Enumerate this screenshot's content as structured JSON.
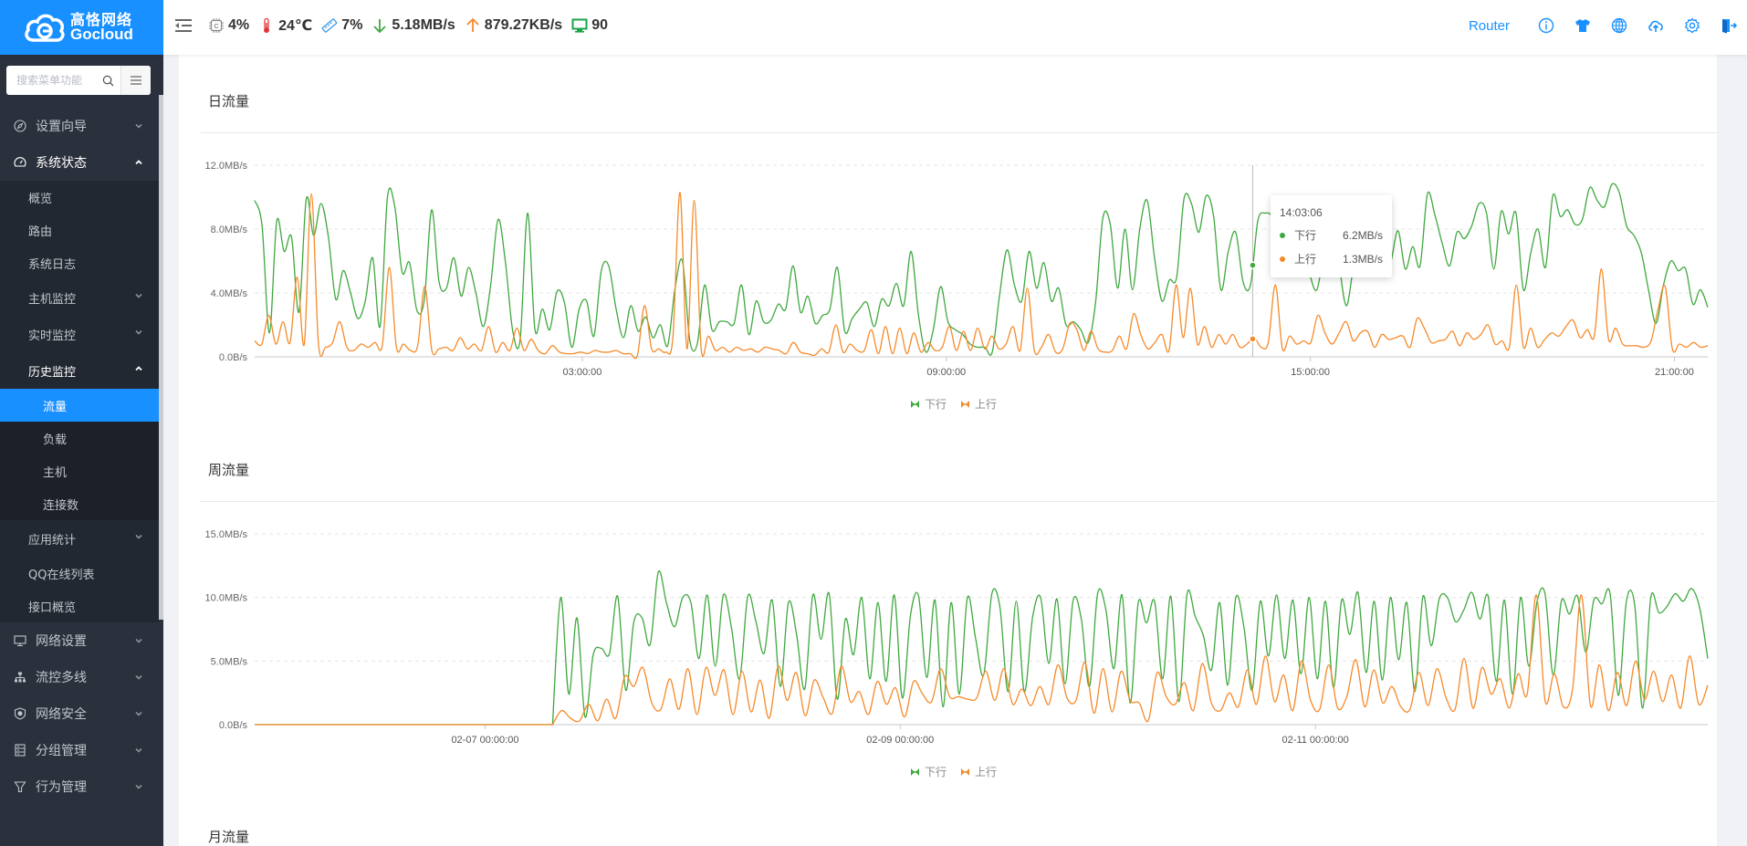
{
  "header": {
    "brand_cn": "高恪网络",
    "brand_en": "Gocloud",
    "stats": {
      "cpu": "4%",
      "temperature": "24℃",
      "memory": "7%",
      "download": "5.18MB/s",
      "upload": "879.27KB/s",
      "hosts": "90"
    },
    "router_label": "Router",
    "icons": [
      "info-icon",
      "theme-shirt-icon",
      "globe-icon",
      "cloud-upload-icon",
      "settings-gear-icon",
      "logout-icon"
    ]
  },
  "colors": {
    "brand": "#1890ff",
    "download": "#3fa83f",
    "upload": "#f58a2a",
    "temperature": "#e5333a",
    "sidebar_bg": "#2b313c"
  },
  "sidebar": {
    "search_placeholder": "搜索菜单功能",
    "menu": [
      {
        "label": "设置向导",
        "icon": "compass-icon",
        "expanded": false
      },
      {
        "label": "系统状态",
        "icon": "dashboard-icon",
        "expanded": true,
        "children": [
          {
            "label": "概览"
          },
          {
            "label": "路由"
          },
          {
            "label": "系统日志"
          },
          {
            "label": "主机监控",
            "has_children": true,
            "expanded": false
          },
          {
            "label": "实时监控",
            "has_children": true,
            "expanded": false
          },
          {
            "label": "历史监控",
            "has_children": true,
            "expanded": true,
            "children": [
              {
                "label": "流量",
                "active": true
              },
              {
                "label": "负载"
              },
              {
                "label": "主机"
              },
              {
                "label": "连接数"
              }
            ]
          },
          {
            "label": "应用统计",
            "has_children": true,
            "expanded": false
          },
          {
            "label": "QQ在线列表"
          },
          {
            "label": "接口概览"
          }
        ]
      },
      {
        "label": "网络设置",
        "icon": "monitor-icon",
        "expanded": false
      },
      {
        "label": "流控多线",
        "icon": "network-topology-icon",
        "expanded": false
      },
      {
        "label": "网络安全",
        "icon": "shield-icon",
        "expanded": false
      },
      {
        "label": "分组管理",
        "icon": "group-list-icon",
        "expanded": false
      },
      {
        "label": "行为管理",
        "icon": "filter-funnel-icon",
        "expanded": false
      }
    ]
  },
  "main": {
    "sections": [
      {
        "title": "日流量"
      },
      {
        "title": "周流量"
      },
      {
        "title": "月流量"
      }
    ],
    "tooltip": {
      "time": "14:03:06",
      "rows": [
        {
          "name": "下行",
          "value": "6.2MB/s"
        },
        {
          "name": "上行",
          "value": "1.3MB/s"
        }
      ]
    }
  },
  "chart_data": [
    {
      "type": "line",
      "title": "日流量",
      "xlabel": "",
      "ylabel": "",
      "x_unit": "hours",
      "x_range": [
        -2.4,
        21.55
      ],
      "x_ticks": [
        {
          "value": 3,
          "label": "03:00:00"
        },
        {
          "value": 9,
          "label": "09:00:00"
        },
        {
          "value": 15,
          "label": "15:00:00"
        },
        {
          "value": 21,
          "label": "21:00:00"
        }
      ],
      "y_unit": "MB/s",
      "ylim": [
        0,
        12
      ],
      "y_ticks": [
        {
          "value": 0,
          "label": "0.0B/s"
        },
        {
          "value": 4,
          "label": "4.0MB/s"
        },
        {
          "value": 8,
          "label": "8.0MB/s"
        },
        {
          "value": 12,
          "label": "12.0MB/s"
        }
      ],
      "grid": true,
      "legend": "bottom-center",
      "crosshair_x": 14.05,
      "series": [
        {
          "name": "下行",
          "color": "#3fa83f",
          "values": [
            9.8,
            8.2,
            1.5,
            8.5,
            6.6,
            7.5,
            2.8,
            9.9,
            7.6,
            9.6,
            7.5,
            3.6,
            5.4,
            4.0,
            2.4,
            3.5,
            6.2,
            1.9,
            10.0,
            9.4,
            5.3,
            5.9,
            2.9,
            3.6,
            9.2,
            4.7,
            4.3,
            6.2,
            3.8,
            5.6,
            4.0,
            1.9,
            4.5,
            8.6,
            5.9,
            1.6,
            1.1,
            9.0,
            1.7,
            3.0,
            1.7,
            4.1,
            3.4,
            0.6,
            3.0,
            3.5,
            1.3,
            5.4,
            5.7,
            3.0,
            1.2,
            3.2,
            1.6,
            2.5,
            1.2,
            2.0,
            0.7,
            4.3,
            6.0,
            1.0,
            0.8,
            4.5,
            1.7,
            2.2,
            2.2,
            2.1,
            4.5,
            1.4,
            3.5,
            2.2,
            2.3,
            3.3,
            3.0,
            5.7,
            2.8,
            3.8,
            2.1,
            2.6,
            3.0,
            5.6,
            1.6,
            2.4,
            3.0,
            3.4,
            1.9,
            3.6,
            3.2,
            4.6,
            3.2,
            6.6,
            2.6,
            0.3,
            1.7,
            4.4,
            2.2,
            1.7,
            1.4,
            0.8,
            0.6,
            0.6,
            0.3,
            3.9,
            6.7,
            4.5,
            3.5,
            6.6,
            4.3,
            5.9,
            3.5,
            4.3,
            2.0,
            2.2,
            1.7,
            0.9,
            3.4,
            8.7,
            8.3,
            4.3,
            8.0,
            4.2,
            8.0,
            9.8,
            6.2,
            3.5,
            4.8,
            5.0,
            9.9,
            9.6,
            7.8,
            10.1,
            8.8,
            4.2,
            6.6,
            7.8,
            4.7,
            4.5,
            8.5,
            9.0,
            8.7,
            6.9,
            6.2,
            7.9,
            6.7,
            5.2,
            4.2,
            6.8,
            10.0,
            6.0,
            3.2,
            5.6,
            6.2,
            6.1,
            8.7,
            5.8,
            5.9,
            7.9,
            5.5,
            6.9,
            5.7,
            10.2,
            8.9,
            7.1,
            5.7,
            7.8,
            7.4,
            8.2,
            9.6,
            9.0,
            5.5,
            9.1,
            7.7,
            9.0,
            4.2,
            6.5,
            8.0,
            5.6,
            10.1,
            8.8,
            9.2,
            8.3,
            8.6,
            10.6,
            9.8,
            9.4,
            10.8,
            10.3,
            8.2,
            7.6,
            6.5,
            4.1,
            2.1,
            4.5,
            6.0,
            5.4,
            5.5,
            3.3,
            4.2,
            3.1
          ]
        },
        {
          "name": "上行",
          "color": "#f58a2a",
          "values": [
            1.0,
            0.8,
            2.6,
            0.8,
            2.2,
            0.9,
            5.0,
            0.8,
            10.2,
            0.8,
            0.6,
            0.9,
            2.2,
            0.6,
            0.4,
            0.8,
            0.6,
            0.9,
            0.7,
            5.6,
            0.6,
            0.8,
            0.4,
            0.7,
            4.4,
            0.4,
            0.5,
            0.6,
            0.4,
            1.2,
            0.5,
            0.8,
            0.4,
            1.9,
            0.3,
            0.9,
            0.4,
            1.8,
            0.4,
            1.1,
            0.4,
            0.2,
            0.7,
            0.3,
            0.2,
            0.2,
            0.3,
            0.2,
            0.4,
            0.3,
            0.3,
            0.4,
            0.2,
            0.2,
            0.1,
            3.2,
            0.5,
            0.5,
            0.3,
            1.2,
            10.3,
            0.5,
            9.8,
            0.5,
            1.3,
            0.4,
            0.6,
            0.3,
            0.6,
            0.4,
            0.5,
            0.3,
            0.6,
            0.5,
            0.4,
            0.2,
            0.9,
            0.3,
            0.2,
            0.1,
            0.5,
            0.3,
            2.0,
            0.3,
            0.8,
            0.4,
            0.4,
            1.7,
            0.2,
            1.9,
            0.2,
            1.8,
            0.2,
            1.5,
            0.3,
            0.9,
            0.4,
            0.6,
            1.9,
            0.4,
            1.6,
            0.4,
            1.8,
            0.5,
            1.3,
            0.5,
            0.8,
            1.9,
            0.4,
            4.3,
            0.4,
            0.6,
            1.4,
            0.3,
            0.5,
            2.1,
            1.7,
            0.4,
            1.6,
            0.5,
            0.3,
            0.4,
            1.3,
            0.5,
            2.7,
            1.4,
            0.5,
            0.9,
            1.4,
            0.4,
            4.5,
            1.2,
            4.3,
            0.8,
            1.9,
            0.6,
            1.4,
            0.8,
            1.4,
            0.6,
            0.8,
            1.2,
            0.6,
            0.9,
            4.5,
            0.5,
            1.3,
            0.8,
            1.0,
            0.9,
            2.6,
            1.5,
            0.8,
            1.5,
            2.2,
            1.0,
            1.5,
            1.6,
            0.6,
            1.4,
            1.1,
            1.2,
            1.3,
            0.6,
            2.4,
            1.8,
            0.9,
            1.0,
            1.1,
            1.6,
            0.7,
            1.5,
            1.1,
            1.4,
            2.0,
            0.8,
            1.0,
            0.6,
            4.5,
            0.6,
            1.8,
            0.6,
            1.1,
            1.5,
            1.3,
            1.9,
            2.3,
            1.2,
            1.7,
            1.3,
            5.5,
            1.1,
            1.8,
            0.8,
            0.7,
            0.7,
            0.6,
            1.0,
            3.0,
            4.4,
            0.5,
            0.8,
            0.6,
            0.9,
            0.6,
            0.7
          ]
        }
      ]
    },
    {
      "type": "line",
      "title": "周流量",
      "xlabel": "",
      "ylabel": "",
      "x_unit": "days since 02-07 00:00:00",
      "x_range": [
        -1.11,
        5.89
      ],
      "x_ticks": [
        {
          "value": 0,
          "label": "02-07 00:00:00"
        },
        {
          "value": 2,
          "label": "02-09 00:00:00"
        },
        {
          "value": 4,
          "label": "02-11 00:00:00"
        }
      ],
      "y_unit": "MB/s",
      "ylim": [
        0,
        15
      ],
      "y_ticks": [
        {
          "value": 0,
          "label": "0.0B/s"
        },
        {
          "value": 5,
          "label": "5.0MB/s"
        },
        {
          "value": 10,
          "label": "10.0MB/s"
        },
        {
          "value": 15,
          "label": "15.0MB/s"
        }
      ],
      "grid": true,
      "legend": "bottom-center",
      "data_start_x": 0.325,
      "series": [
        {
          "name": "下行",
          "color": "#3fa83f",
          "values": [
            0,
            10.0,
            2.4,
            8.4,
            0.6,
            5.5,
            6.0,
            5.6,
            10.1,
            2.7,
            8.1,
            8.4,
            6.3,
            12.0,
            9.6,
            7.7,
            10.0,
            9.6,
            5.2,
            10.2,
            4.6,
            10.2,
            7.6,
            3.6,
            10.1,
            8.1,
            5.6,
            9.8,
            3.0,
            9.6,
            7.1,
            2.8,
            10.2,
            6.7,
            10.3,
            2.0,
            8.3,
            5.5,
            10.0,
            3.6,
            9.6,
            3.4,
            10.2,
            2.1,
            8.6,
            10.1,
            3.7,
            9.8,
            1.4,
            9.6,
            2.4,
            10.0,
            6.8,
            3.9,
            10.3,
            9.2,
            2.6,
            9.7,
            2.6,
            8.4,
            10.0,
            4.8,
            9.9,
            3.2,
            9.8,
            8.3,
            3.0,
            10.3,
            9.1,
            4.4,
            10.2,
            1.7,
            9.6,
            8.0,
            9.7,
            3.6,
            10.1,
            1.8,
            10.3,
            8.5,
            7.0,
            4.3,
            9.6,
            3.1,
            10.0,
            7.6,
            2.7,
            9.7,
            5.4,
            10.2,
            5.2,
            9.8,
            4.0,
            10.0,
            3.6,
            9.7,
            2.9,
            9.8,
            7.1,
            10.4,
            4.1,
            9.7,
            3.5,
            10.0,
            5.1,
            9.6,
            2.6,
            10.1,
            6.2,
            9.9,
            10.0,
            8.1,
            9.0,
            10.4,
            8.3,
            10.1,
            3.4,
            9.8,
            2.4,
            10.0,
            4.6,
            9.6,
            10.3,
            3.9,
            9.7,
            8.7,
            10.1,
            5.7,
            9.8,
            9.5,
            10.3,
            2.3,
            9.7,
            9.5,
            1.3,
            10.0,
            8.8,
            9.3,
            10.3,
            9.7,
            10.7,
            9.2,
            5.2
          ]
        },
        {
          "name": "上行",
          "color": "#f58a2a",
          "values": [
            0,
            1.1,
            0.5,
            0.3,
            1.6,
            0.3,
            2.0,
            0.5,
            3.8,
            3.0,
            4.5,
            1.7,
            1.2,
            3.6,
            1.2,
            4.4,
            0.8,
            4.5,
            2.3,
            4.3,
            0.8,
            4.2,
            1.0,
            3.5,
            0.5,
            4.6,
            1.9,
            4.1,
            0.7,
            3.5,
            2.1,
            0.9,
            4.6,
            1.8,
            2.6,
            0.8,
            3.4,
            1.6,
            2.9,
            0.6,
            3.4,
            2.4,
            1.8,
            4.4,
            2.2,
            2.2,
            2.0,
            2.1,
            4.2,
            1.9,
            4.4,
            1.6,
            2.8,
            1.5,
            3.0,
            1.6,
            4.7,
            2.1,
            1.9,
            4.9,
            0.9,
            4.4,
            1.0,
            4.2,
            1.9,
            1.7,
            0.3,
            4.1,
            2.2,
            1.6,
            3.3,
            1.1,
            4.8,
            1.7,
            1.1,
            2.5,
            1.4,
            4.3,
            1.6,
            5.4,
            1.8,
            3.9,
            1.1,
            5.0,
            1.9,
            1.2,
            4.7,
            1.3,
            2.2,
            5.1,
            1.4,
            4.3,
            1.7,
            3.0,
            1.4,
            1.2,
            4.1,
            1.5,
            4.4,
            2.1,
            1.2,
            5.2,
            1.3,
            4.5,
            2.4,
            3.6,
            1.3,
            4.0,
            2.4,
            10.2,
            1.8,
            4.0,
            1.4,
            2.7,
            10.2,
            1.5,
            4.7,
            1.1,
            4.1,
            1.5,
            5.0,
            2.0,
            4.2,
            1.8,
            3.9,
            1.3,
            5.4,
            1.6,
            3.1
          ]
        }
      ]
    }
  ]
}
